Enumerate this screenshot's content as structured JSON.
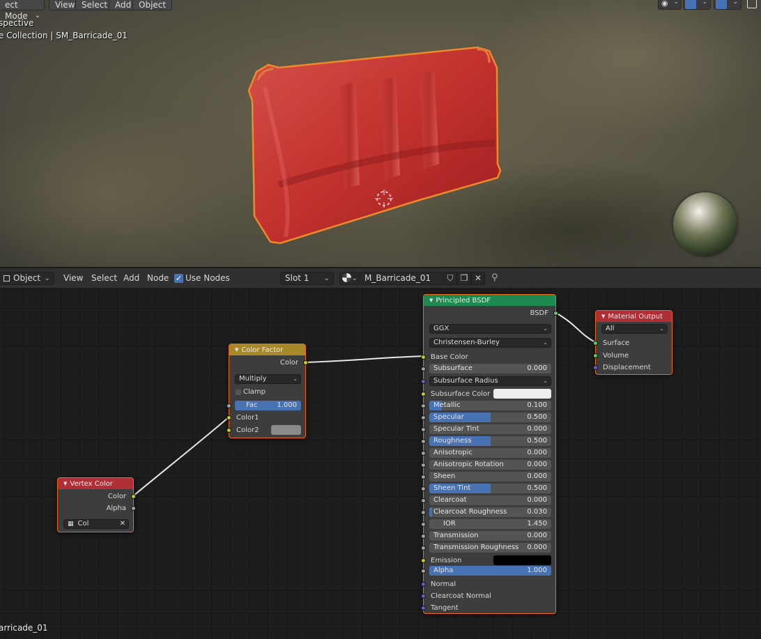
{
  "viewport": {
    "mode_label": "ect Mode",
    "menu": [
      "View",
      "Select",
      "Add",
      "Object"
    ],
    "overlay_line1": "spective",
    "overlay_line2": "e Collection | SM_Barricade_01",
    "bottom_label": "arricade_01",
    "object_color": "#c8302e",
    "selection_outline_color": "#ee8a2a"
  },
  "node_header": {
    "context_dropdown": "Object",
    "menu": [
      "View",
      "Select",
      "Add",
      "Node"
    ],
    "use_nodes_label": "Use Nodes",
    "use_nodes_checked": true,
    "slot_dropdown": "Slot 1",
    "material_name": "M_Barricade_01",
    "icons": [
      "shield-icon",
      "duplicate-icon",
      "close-icon",
      "pin-icon"
    ]
  },
  "nodes": {
    "vertex_color": {
      "title": "Vertex Color",
      "outputs": [
        "Color",
        "Alpha"
      ],
      "layer_value": "Col",
      "header_color": "#b02e35"
    },
    "color_factor": {
      "title": "Color Factor",
      "output": "Color",
      "blend_mode": "Multiply",
      "clamp_label": "Clamp",
      "clamp_checked": false,
      "fac_label": "Fac",
      "fac_value": "1.000",
      "color1_label": "Color1",
      "color2_label": "Color2",
      "color2_swatch": "#8a8a8a",
      "header_color": "#a8892a"
    },
    "principled": {
      "title": "Principled BSDF",
      "output": "BSDF",
      "distribution": "GGX",
      "subsurface_method": "Christensen-Burley",
      "base_color_label": "Base Color",
      "subsurface_radius_label": "Subsurface Radius",
      "subsurface_color_label": "Subsurface Color",
      "subsurface_color_swatch": "#eeeeee",
      "emission_label": "Emission",
      "emission_swatch": "#000000",
      "header_color": "#1e8a4f",
      "fields": [
        {
          "label": "Subsurface",
          "value": "0.000",
          "fill": 0
        },
        {
          "label": "Metallic",
          "value": "0.100",
          "fill": 0.1
        },
        {
          "label": "Specular",
          "value": "0.500",
          "fill": 0.5
        },
        {
          "label": "Specular Tint",
          "value": "0.000",
          "fill": 0
        },
        {
          "label": "Roughness",
          "value": "0.500",
          "fill": 0.5
        },
        {
          "label": "Anisotropic",
          "value": "0.000",
          "fill": 0
        },
        {
          "label": "Anisotropic Rotation",
          "value": "0.000",
          "fill": 0
        },
        {
          "label": "Sheen",
          "value": "0.000",
          "fill": 0
        },
        {
          "label": "Sheen Tint",
          "value": "0.500",
          "fill": 0.5
        },
        {
          "label": "Clearcoat",
          "value": "0.000",
          "fill": 0
        },
        {
          "label": "Clearcoat Roughness",
          "value": "0.030",
          "fill": 0.03
        },
        {
          "label": "IOR",
          "value": "1.450",
          "fill": 0
        },
        {
          "label": "Transmission",
          "value": "0.000",
          "fill": 0
        },
        {
          "label": "Transmission Roughness",
          "value": "0.000",
          "fill": 0
        },
        {
          "label": "Alpha",
          "value": "1.000",
          "fill": 1
        }
      ],
      "normal_label": "Normal",
      "clearcoat_normal_label": "Clearcoat Normal",
      "tangent_label": "Tangent"
    },
    "material_output": {
      "title": "Material Output",
      "target": "All",
      "inputs": [
        "Surface",
        "Volume",
        "Displacement"
      ],
      "header_color": "#b02e35"
    }
  }
}
